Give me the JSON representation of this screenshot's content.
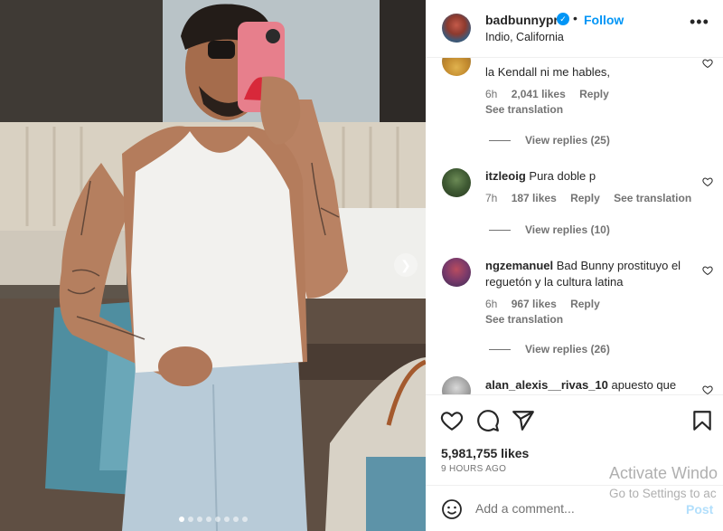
{
  "post": {
    "username": "badbunnypr",
    "follow_label": "Follow",
    "location": "Indio, California",
    "more_icon": "more-options-icon",
    "photo_alt": "carousel photo",
    "carousel_dot_count": 8,
    "carousel_active_index": 0
  },
  "comments": [
    {
      "username": "",
      "text": "la Kendall ni me hables,",
      "time": "6h",
      "likes": "2,041 likes",
      "reply": "Reply",
      "see_translation": "See translation",
      "view_replies": "View replies (25)"
    },
    {
      "username": "itzleoig",
      "text": "Pura doble p",
      "time": "7h",
      "likes": "187 likes",
      "reply": "Reply",
      "see_translation": "See translation",
      "view_replies": "View replies (10)"
    },
    {
      "username": "ngzemanuel",
      "text": "Bad Bunny prostituyo el reguetón y la cultura latina",
      "time": "6h",
      "likes": "967 likes",
      "reply": "Reply",
      "see_translation": "See translation",
      "view_replies": "View replies (26)"
    },
    {
      "username": "alan_alexis__rivas_10",
      "text": "apuesto que"
    }
  ],
  "actions": {
    "like_icon": "heart-icon",
    "comment_icon": "comment-icon",
    "share_icon": "share-icon",
    "save_icon": "bookmark-icon",
    "likes": "5,981,755 likes",
    "time_ago": "9 HOURS AGO"
  },
  "add_comment": {
    "placeholder": "Add a comment...",
    "post_label": "Post"
  },
  "os_watermark": {
    "line1": "Activate Windo",
    "line2": "Go to Settings to ac"
  },
  "colors": {
    "accent": "#0095f6",
    "post_disabled": "#b2dffc",
    "muted": "#737373"
  }
}
